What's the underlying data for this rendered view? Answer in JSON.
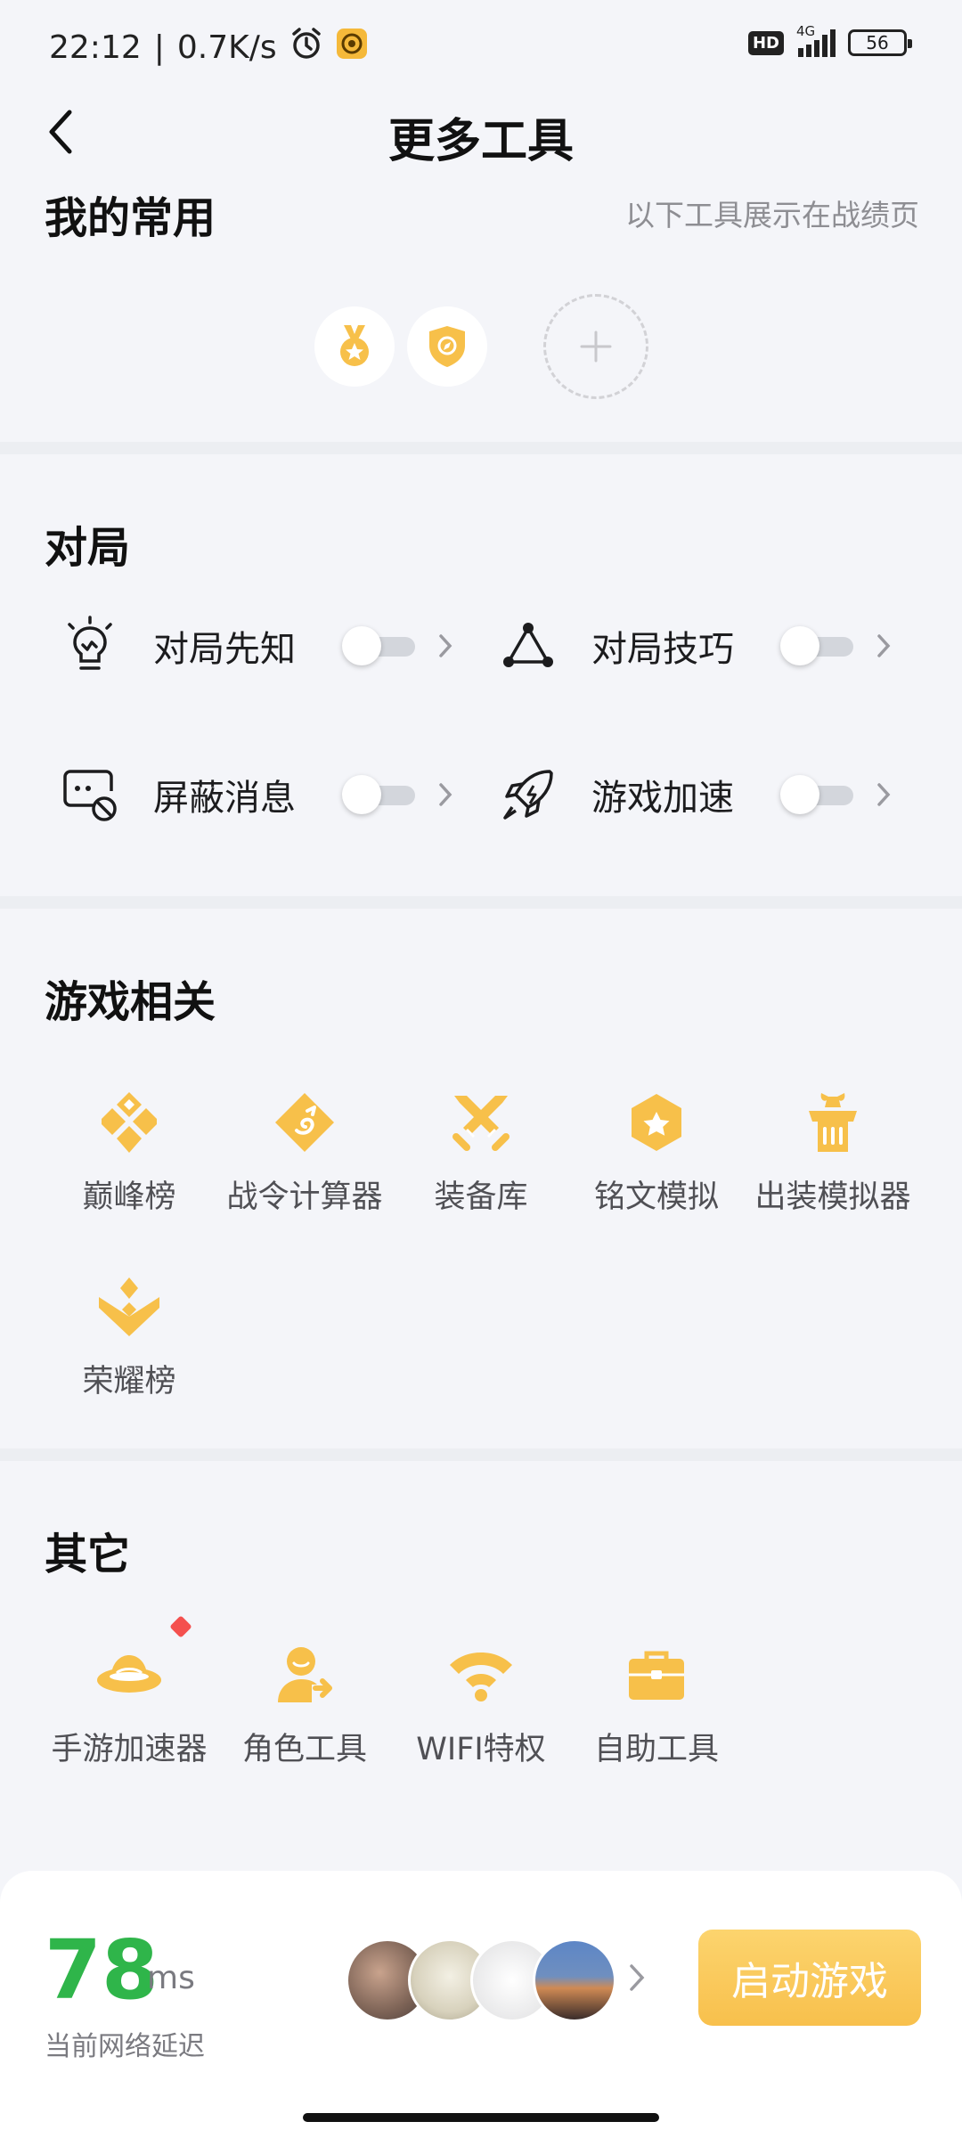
{
  "status_bar": {
    "time": "22:12",
    "separator": "|",
    "speed": "0.7K/s",
    "hd": "HD",
    "network": "4G",
    "battery": "56"
  },
  "nav": {
    "title": "更多工具"
  },
  "favorites": {
    "title": "我的常用",
    "hint": "以下工具展示在战绩页"
  },
  "battle": {
    "title": "对局",
    "items": [
      {
        "label": "对局先知",
        "icon": "lightbulb-icon",
        "enabled": false
      },
      {
        "label": "对局技巧",
        "icon": "triangle-nodes-icon",
        "enabled": false
      },
      {
        "label": "屏蔽消息",
        "icon": "block-message-icon",
        "enabled": false
      },
      {
        "label": "游戏加速",
        "icon": "rocket-icon",
        "enabled": false
      }
    ]
  },
  "game": {
    "title": "游戏相关",
    "items": [
      {
        "label": "巅峰榜",
        "icon": "peak-rank-icon"
      },
      {
        "label": "战令计算器",
        "icon": "dragon-badge-icon"
      },
      {
        "label": "装备库",
        "icon": "crossed-swords-icon"
      },
      {
        "label": "铭文模拟",
        "icon": "hexagon-star-icon"
      },
      {
        "label": "出装模拟器",
        "icon": "armor-icon"
      },
      {
        "label": "荣耀榜",
        "icon": "glory-rank-icon"
      }
    ]
  },
  "other": {
    "title": "其它",
    "items": [
      {
        "label": "手游加速器",
        "icon": "ufo-icon",
        "badge": true
      },
      {
        "label": "角色工具",
        "icon": "user-arrow-icon"
      },
      {
        "label": "WIFI特权",
        "icon": "wifi-icon"
      },
      {
        "label": "自助工具",
        "icon": "toolbox-icon"
      }
    ]
  },
  "bottom": {
    "latency_value": "78",
    "latency_unit": "ms",
    "latency_label": "当前网络延迟",
    "start_label": "启动游戏"
  },
  "colors": {
    "accent_gold": "#f7c04a",
    "latency_green": "#2fb54a",
    "badge_red": "#f4504e"
  }
}
